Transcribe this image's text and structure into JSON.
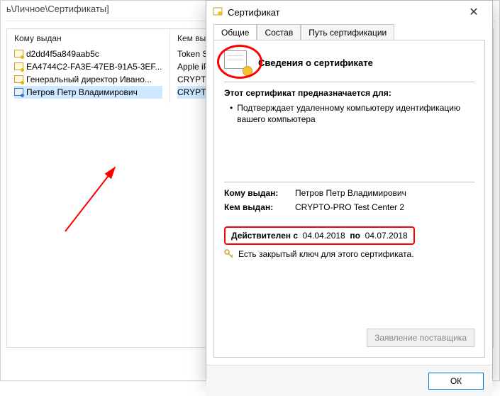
{
  "main": {
    "breadcrumb": "ь\\Личное\\Сертификаты]",
    "col1_header": "Кому выдан",
    "col2_header": "Кем выдан",
    "rows": [
      {
        "subject": "d2dd4f5a849aab5c",
        "issuer": "Token Signin"
      },
      {
        "subject": "EA4744C2-FA3E-47EB-91A5-3EF...",
        "issuer": "Apple iPhone"
      },
      {
        "subject": "Генеральный директор Ивано...",
        "issuer": "CRYPTO-PRO"
      },
      {
        "subject": "Петров Петр Владимирович",
        "issuer": "CRYPTO-PRO"
      }
    ]
  },
  "dlg": {
    "title": "Сертификат",
    "tabs": {
      "general": "Общие",
      "composition": "Состав",
      "path": "Путь сертификации"
    },
    "info_header": "Сведения о сертификате",
    "purpose_header": "Этот сертификат предназначается для:",
    "purpose_item": "Подтверждает удаленному компьютеру идентификацию вашего компьютера",
    "issued_to_label": "Кому выдан:",
    "issued_to_value": "Петров Петр Владимирович",
    "issued_by_label": "Кем выдан:",
    "issued_by_value": "CRYPTO-PRO Test Center 2",
    "valid_prefix": "Действителен с",
    "valid_from": "04.04.2018",
    "valid_sep": "по",
    "valid_to": "04.07.2018",
    "key_note": "Есть закрытый ключ для этого сертификата.",
    "supplier_btn": "Заявление поставщика",
    "ok": "ОК"
  }
}
